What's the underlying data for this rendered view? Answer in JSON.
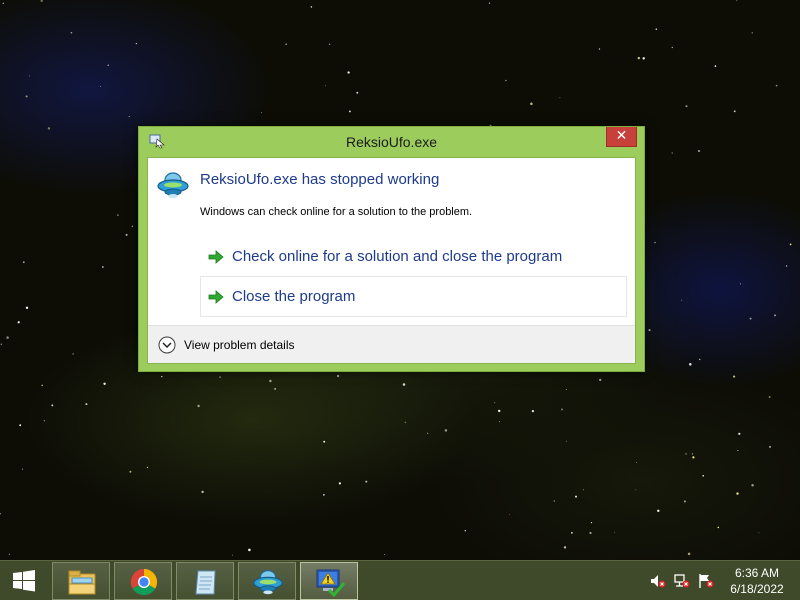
{
  "window": {
    "title": "ReksioUfo.exe",
    "close_glyph": "✕"
  },
  "dialog": {
    "main_instruction": "ReksioUfo.exe has stopped working",
    "content": "Windows can check online for a solution to the problem.",
    "commands": [
      {
        "label": "Check online for a solution and close the program",
        "icon": "green-arrow-icon"
      },
      {
        "label": "Close the program",
        "icon": "green-arrow-icon"
      }
    ],
    "details_label": "View problem details",
    "app_icon": "ufo-icon"
  },
  "taskbar": {
    "buttons": [
      {
        "name": "file-explorer",
        "icon": "folder-icon"
      },
      {
        "name": "chrome",
        "icon": "chrome-icon"
      },
      {
        "name": "notepad",
        "icon": "notepad-icon"
      },
      {
        "name": "reksio-ufo",
        "icon": "ufo-icon"
      },
      {
        "name": "problem-reporting",
        "icon": "warning-monitor-icon",
        "active": true
      }
    ],
    "tray_icons": [
      "volume-muted-icon",
      "network-error-icon",
      "action-center-flag-icon"
    ],
    "clock": {
      "time": "6:36 AM",
      "date": "6/18/2022"
    }
  },
  "colors": {
    "accent_green": "#9ccd5c",
    "link_blue": "#1e3a8b",
    "close_red": "#c7403a",
    "taskbar": "#3f4a2a"
  }
}
